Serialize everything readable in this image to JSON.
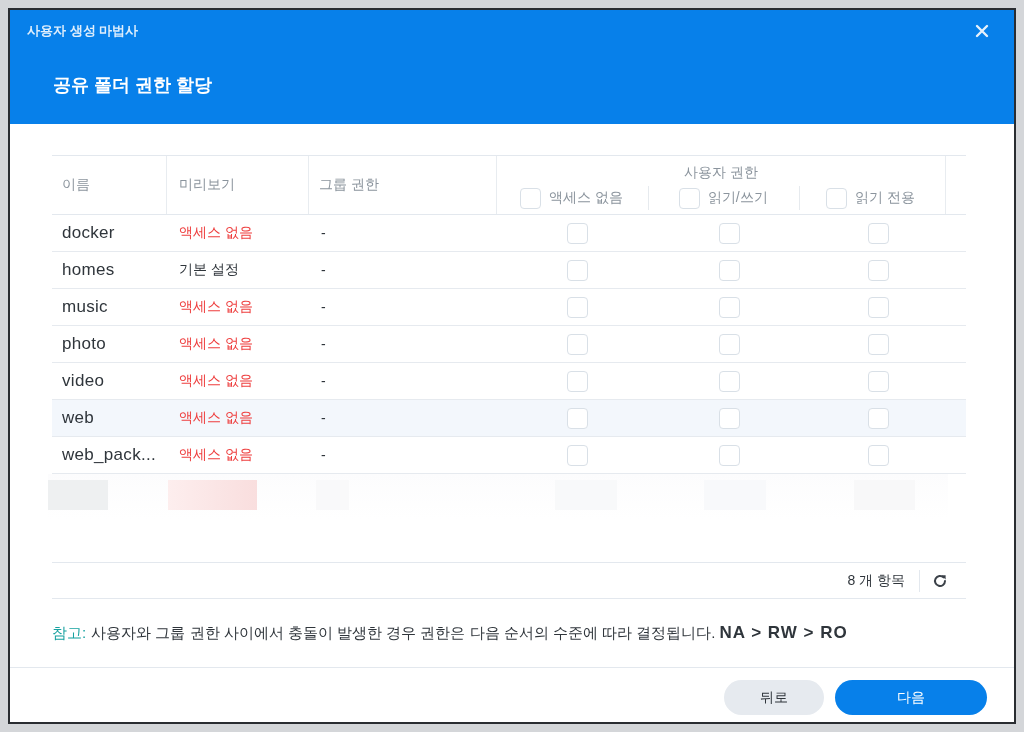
{
  "dialog": {
    "title": "사용자 생성 마법사",
    "heading": "공유 폴더 권한 할당"
  },
  "table": {
    "columns": [
      {
        "label": "이름"
      },
      {
        "label": "미리보기"
      },
      {
        "label": "그룹 권한"
      }
    ],
    "permission_group": {
      "label": "사용자 권한",
      "options": [
        {
          "label": "액세스 없음",
          "checked": false
        },
        {
          "label": "읽기/쓰기",
          "checked": false
        },
        {
          "label": "읽기 전용",
          "checked": false
        }
      ]
    },
    "rows": [
      {
        "name": "docker",
        "preview": {
          "text": "액세스 없음",
          "kind": "denied"
        },
        "group_permission": "-",
        "hovered": false,
        "permissions": [
          {
            "checked": false
          },
          {
            "checked": false
          },
          {
            "checked": false
          }
        ]
      },
      {
        "name": "homes",
        "preview": {
          "text": "기본 설정",
          "kind": "default"
        },
        "group_permission": "-",
        "hovered": false,
        "permissions": [
          {
            "checked": false
          },
          {
            "checked": false
          },
          {
            "checked": false
          }
        ]
      },
      {
        "name": "music",
        "preview": {
          "text": "액세스 없음",
          "kind": "denied"
        },
        "group_permission": "-",
        "hovered": false,
        "permissions": [
          {
            "checked": false
          },
          {
            "checked": false
          },
          {
            "checked": false
          }
        ]
      },
      {
        "name": "photo",
        "preview": {
          "text": "액세스 없음",
          "kind": "denied"
        },
        "group_permission": "-",
        "hovered": false,
        "permissions": [
          {
            "checked": false
          },
          {
            "checked": false
          },
          {
            "checked": false
          }
        ]
      },
      {
        "name": "video",
        "preview": {
          "text": "액세스 없음",
          "kind": "denied"
        },
        "group_permission": "-",
        "hovered": false,
        "permissions": [
          {
            "checked": false
          },
          {
            "checked": false
          },
          {
            "checked": false
          }
        ]
      },
      {
        "name": "web",
        "preview": {
          "text": "액세스 없음",
          "kind": "denied"
        },
        "group_permission": "-",
        "hovered": true,
        "permissions": [
          {
            "checked": false
          },
          {
            "checked": false
          },
          {
            "checked": false
          }
        ]
      },
      {
        "name": "web_pack...",
        "preview": {
          "text": "액세스 없음",
          "kind": "denied"
        },
        "group_permission": "-",
        "hovered": false,
        "permissions": [
          {
            "checked": false
          },
          {
            "checked": false
          },
          {
            "checked": false
          }
        ]
      }
    ]
  },
  "footer": {
    "item_count": "8 개 항목"
  },
  "note": {
    "label": "참고:",
    "text": "사용자와 그룹 권한 사이에서 충돌이 발생한 경우 권한은 다음 순서의 수준에 따라 결정됩니다. **NA > RW > RO**"
  },
  "buttons": [
    {
      "label": "뒤로",
      "kind": "secondary"
    },
    {
      "label": "다음",
      "kind": "primary"
    }
  ]
}
